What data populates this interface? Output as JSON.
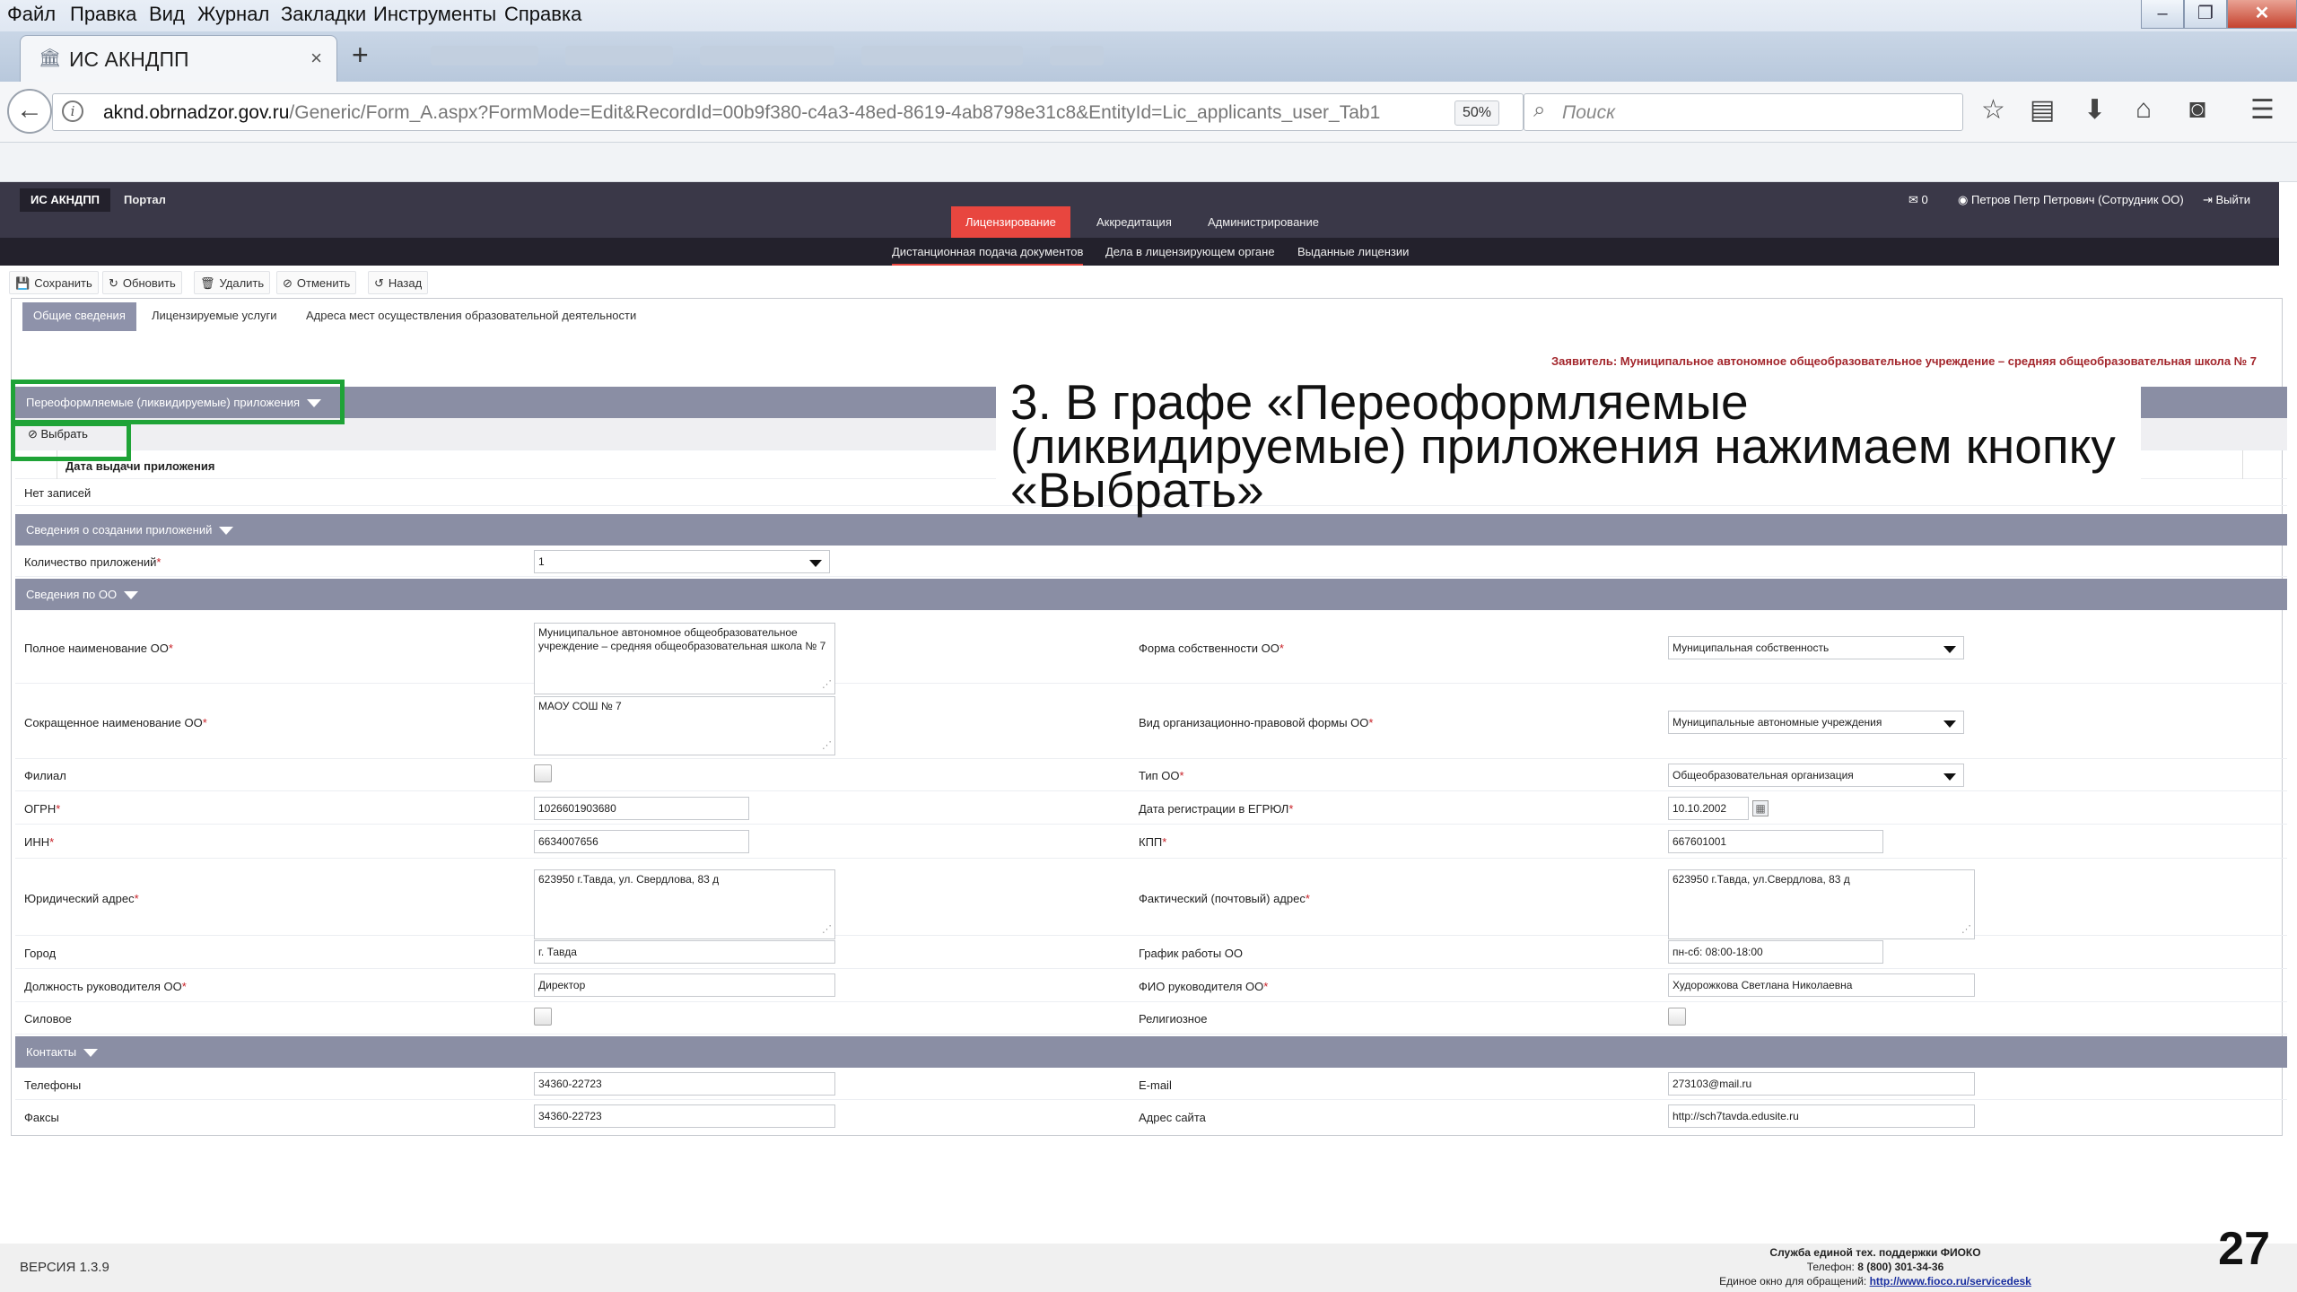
{
  "menu": [
    "Файл",
    "Правка",
    "Вид",
    "Журнал",
    "Закладки",
    "Инструменты",
    "Справка"
  ],
  "browser": {
    "tab_title": "ИС АКНДПП",
    "url_host": "aknd.obrnadzor.gov.ru",
    "url_path": "/Generic/Form_A.aspx?FormMode=Edit&RecordId=00b9f380-c4a3-48ed-8619-4ab8798e31c8&EntityId=Lic_applicants_user_Tab1",
    "zoom": "50%",
    "search_placeholder": "Поиск"
  },
  "app": {
    "brand": "ИС АКНДПП",
    "portal": "Портал",
    "messages_count": "0",
    "user": "Петров Петр Петрович (Сотрудник ОО)",
    "logout": "Выйти",
    "nav": [
      "Лицензирование",
      "Аккредитация",
      "Администрирование"
    ],
    "subnav": [
      "Дистанционная подача документов",
      "Дела в лицензирующем органе",
      "Выданные лицензии"
    ]
  },
  "toolbar": {
    "save": "Сохранить",
    "refresh": "Обновить",
    "delete": "Удалить",
    "cancel": "Отменить",
    "back": "Назад"
  },
  "form_tabs": [
    "Общие сведения",
    "Лицензируемые услуги",
    "Адреса мест осуществления образовательной деятельности"
  ],
  "applicant": "Заявитель: Муниципальное автономное общеобразовательное учреждение – средняя общеобразовательная школа № 7",
  "appendix_section": {
    "title": "Переоформляемые (ликвидируемые) приложения",
    "select_button": "Выбрать",
    "column": "Дата выдачи приложения",
    "empty": "Нет записей"
  },
  "creation_section": {
    "title": "Сведения о создании приложений",
    "count_label": "Количество приложений",
    "count_value": "1"
  },
  "org_section": {
    "title": "Сведения по ОО",
    "full_name_label": "Полное наименование ОО",
    "full_name": "Муниципальное автономное общеобразовательное учреждение – средняя общеобразовательная школа № 7",
    "ownership_label": "Форма собственности ОО",
    "ownership": "Муниципальная собственность",
    "short_name_label": "Сокращенное наименование ОО",
    "short_name": "МАОУ СОШ № 7",
    "legal_form_label": "Вид организационно-правовой формы ОО",
    "legal_form": "Муниципальные автономные учреждения",
    "branch_label": "Филиал",
    "type_label": "Тип ОО",
    "type": "Общеобразовательная организация",
    "ogrn_label": "ОГРН",
    "ogrn": "1026601903680",
    "reg_date_label": "Дата регистрации в ЕГРЮЛ",
    "reg_date": "10.10.2002",
    "inn_label": "ИНН",
    "inn": "6634007656",
    "kpp_label": "КПП",
    "kpp": "667601001",
    "legal_addr_label": "Юридический адрес",
    "legal_addr": "623950 г.Тавда, ул. Свердлова, 83 д",
    "actual_addr_label": "Фактический (почтовый) адрес",
    "actual_addr": "623950 г.Тавда, ул.Свердлова, 83 д",
    "city_label": "Город",
    "city": "г. Тавда",
    "schedule_label": "График работы ОО",
    "schedule": "пн-сб: 08:00-18:00",
    "head_pos_label": "Должность руководителя ОО",
    "head_pos": "Директор",
    "head_name_label": "ФИО руководителя ОО",
    "head_name": "Худорожкова Светлана Николаевна",
    "power_label": "Силовое",
    "religious_label": "Религиозное"
  },
  "contacts_section": {
    "title": "Контакты",
    "phones_label": "Телефоны",
    "phones": "34360-22723",
    "email_label": "E-mail",
    "email": "273103@mail.ru",
    "fax_label": "Факсы",
    "fax": "34360-22723",
    "site_label": "Адрес сайта",
    "site": "http://sch7tavda.edusite.ru"
  },
  "annotation": "3. В графе «Переоформляемые (ликвидируемые) приложения нажимаем кнопку «Выбрать»",
  "footer": {
    "version": "ВЕРСИЯ 1.3.9",
    "support_title": "Служба единой тех. поддержки ФИОКО",
    "support_phone_label": "Телефон:",
    "support_phone": "8 (800) 301-34-36",
    "support_window_label": "Единое окно для обращений:",
    "support_link": "http://www.fioco.ru/servicedesk"
  },
  "page_number": "27",
  "colors": {
    "accent": "#e8463f",
    "header": "#3a3848",
    "section": "#8a8ea4",
    "highlight": "#1fa337",
    "applicant": "#a3262c"
  }
}
